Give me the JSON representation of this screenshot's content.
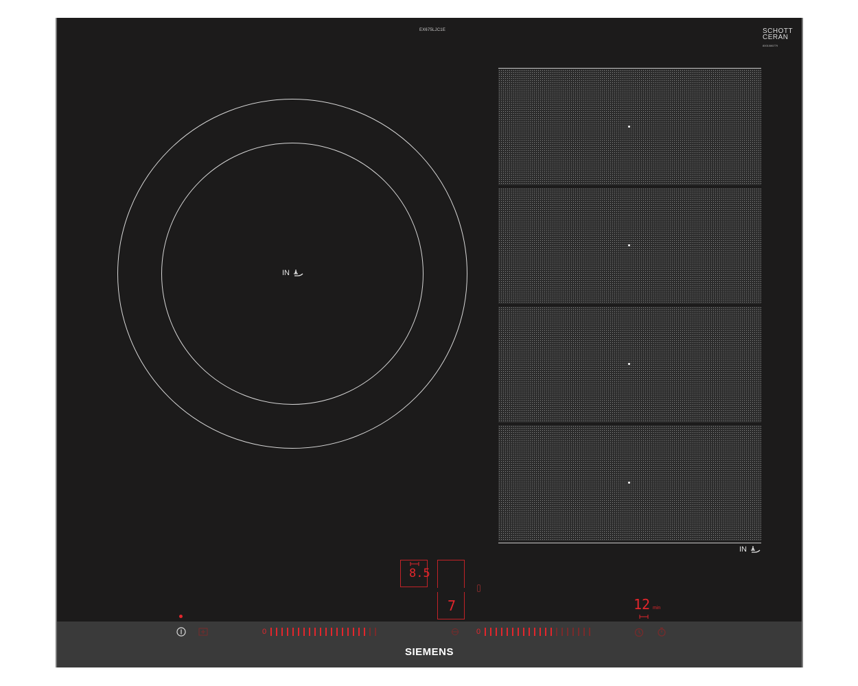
{
  "model": "EX675LJC1E",
  "glass_brand": {
    "line1": "SCHOTT",
    "line2": "CERAN",
    "code": "8001086779"
  },
  "zones": {
    "round_label": "IN",
    "flex_label": "IN"
  },
  "display": {
    "left_power": "8.5",
    "center_level": "7",
    "timer_value": "12",
    "timer_unit": "min"
  },
  "controls": {
    "slider_left_start": "0",
    "slider_right_start": "0",
    "power_icon": "power-icon",
    "brand": "SIEMENS"
  },
  "colors": {
    "glass": "#1c1b1b",
    "led": "#e3262c",
    "strip": "#3a3a3a"
  }
}
